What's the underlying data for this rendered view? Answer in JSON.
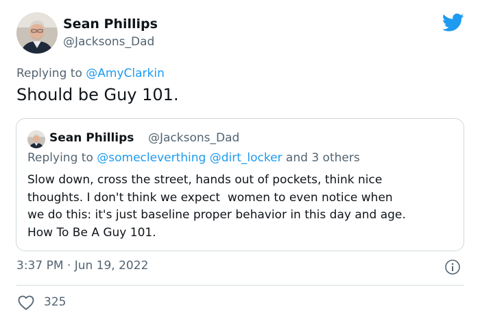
{
  "tweet": {
    "author_name": "Sean Phillips",
    "author_handle": "@Jacksons_Dad",
    "replying_prefix": "Replying to ",
    "replying_to": "@AmyClarkin",
    "text": "Should be Guy 101.",
    "timestamp": "3:37 PM · Jun 19, 2022",
    "likes": "325"
  },
  "quoted": {
    "author_name": "Sean Phillips",
    "author_handle": "@Jacksons_Dad",
    "replying_prefix": "Replying to ",
    "replying_to": "@somecleverthing @dirt_locker",
    "replying_suffix": " and 3 others",
    "lines": [
      "Slow down, cross the street, hands out of pockets, think nice",
      "thoughts. I don't think we expect  women to even notice when",
      "we do this: it's just baseline proper behavior in this day and age.",
      "How To Be A Guy 101."
    ]
  },
  "icons": {
    "brand": "twitter-bird-icon",
    "info": "info-icon",
    "like": "heart-icon"
  },
  "colors": {
    "brand": "#1d9bf0",
    "link": "#1d9bf0",
    "muted": "#536471",
    "text": "#0f1419",
    "border": "#cfd9de"
  }
}
